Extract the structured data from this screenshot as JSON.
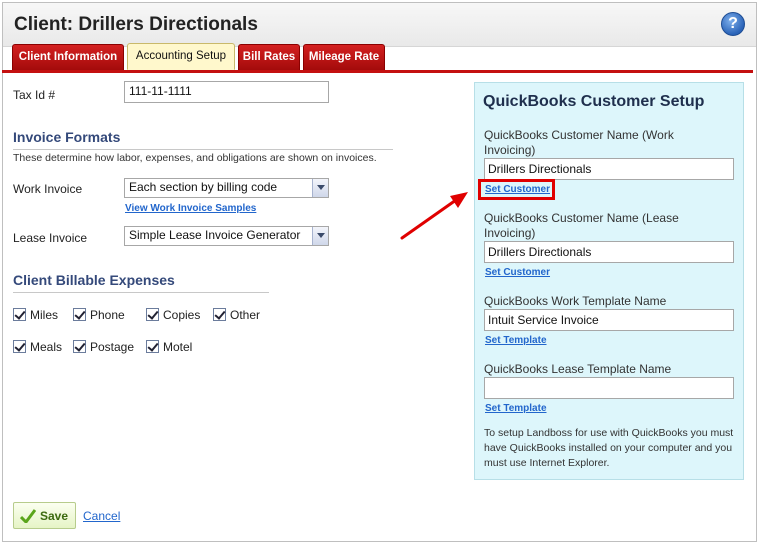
{
  "page": {
    "title": "Client: Drillers Directionals",
    "help_label": "?"
  },
  "tabs": [
    {
      "label": "Client Information"
    },
    {
      "label": "Accounting Setup"
    },
    {
      "label": "Bill Rates"
    },
    {
      "label": "Mileage Rate"
    }
  ],
  "form": {
    "tax_id_label": "Tax Id #",
    "tax_id_value": "111-11-1111",
    "invoice_formats": {
      "heading": "Invoice Formats",
      "description": "These determine how labor, expenses, and obligations are shown on invoices.",
      "work_invoice_label": "Work Invoice",
      "work_invoice_value": "Each section by billing code",
      "view_samples_link": "View Work Invoice Samples",
      "lease_invoice_label": "Lease Invoice",
      "lease_invoice_value": "Simple Lease Invoice Generator"
    },
    "expenses": {
      "heading": "Client Billable Expenses",
      "items": [
        {
          "label": "Miles",
          "checked": true
        },
        {
          "label": "Phone",
          "checked": true
        },
        {
          "label": "Copies",
          "checked": true
        },
        {
          "label": "Other",
          "checked": true
        },
        {
          "label": "Meals",
          "checked": true
        },
        {
          "label": "Postage",
          "checked": true
        },
        {
          "label": "Motel",
          "checked": true
        }
      ]
    }
  },
  "quickbooks": {
    "title": "QuickBooks Customer Setup",
    "work_customer_label": "QuickBooks Customer Name (Work Invoicing)",
    "work_customer_value": "Drillers Directionals",
    "set_customer_link": "Set Customer",
    "lease_customer_label": "QuickBooks Customer Name (Lease Invoicing)",
    "lease_customer_value": "Drillers Directionals",
    "set_customer_link_2": "Set Customer",
    "work_template_label": "QuickBooks Work Template Name",
    "work_template_value": "Intuit Service Invoice",
    "set_template_link": "Set Template",
    "lease_template_label": "QuickBooks Lease Template Name",
    "lease_template_value": "",
    "set_template_link_2": "Set Template",
    "note": "To setup Landboss for use with QuickBooks you must have QuickBooks installed on your computer and you must use Internet Explorer."
  },
  "actions": {
    "save_label": "Save",
    "cancel_label": "Cancel"
  },
  "colors": {
    "tab_red": "#c41010",
    "active_tab": "#fff8cc",
    "panel_bg": "#ddf6fb",
    "annotation_red": "#e00000"
  }
}
